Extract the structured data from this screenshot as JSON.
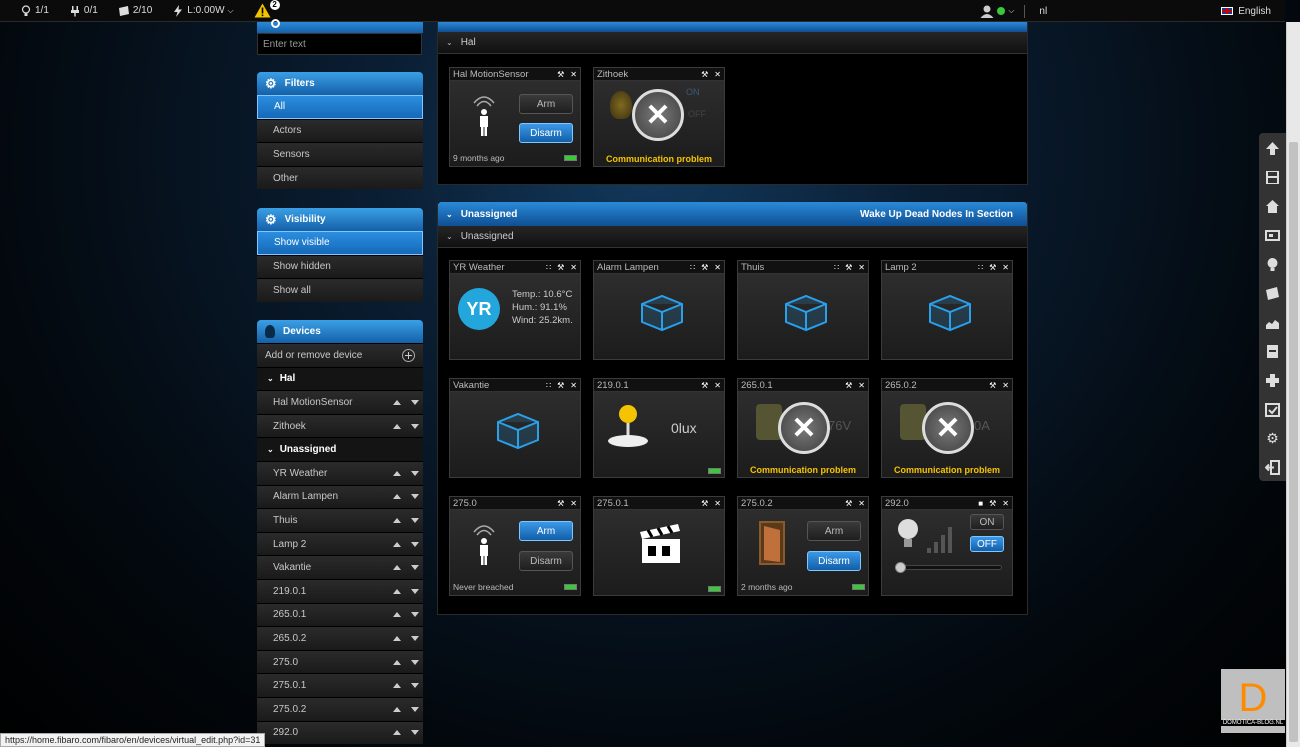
{
  "topbar": {
    "lights": "1/1",
    "plugs": "0/1",
    "blinds": "2/10",
    "power": "L:0.00W",
    "alerts": "2",
    "lang_short": "nl",
    "language": "English"
  },
  "search": {
    "placeholder": "Enter text"
  },
  "filters": {
    "title": "Filters",
    "items": [
      "All",
      "Actors",
      "Sensors",
      "Other"
    ]
  },
  "visibility": {
    "title": "Visibility",
    "items": [
      "Show visible",
      "Show hidden",
      "Show all"
    ]
  },
  "devices": {
    "title": "Devices",
    "add": "Add or remove device",
    "sections": [
      "Hal",
      "Unassigned"
    ],
    "hal_items": [
      "Hal MotionSensor",
      "Zithoek"
    ],
    "unassigned_items": [
      "YR Weather",
      "Alarm Lampen",
      "Thuis",
      "Lamp 2",
      "Vakantie",
      "219.0.1",
      "265.0.1",
      "265.0.2",
      "275.0",
      "275.0.1",
      "275.0.2",
      "292.0"
    ]
  },
  "main": {
    "hal_section": "Hal",
    "unassigned_section": "Unassigned",
    "wake_up": "Wake Up Dead Nodes In Section",
    "tiles": {
      "hal_motion": {
        "title": "Hal MotionSensor",
        "arm": "Arm",
        "disarm": "Disarm",
        "foot": "9 months ago"
      },
      "zithoek": {
        "title": "Zithoek",
        "on": "ON",
        "off": "OFF",
        "status": "Communication problem"
      },
      "yr": {
        "title": "YR Weather",
        "logo": "YR",
        "temp": "Temp.: 10.6°C",
        "hum": "Hum.: 91.1%",
        "wind": "Wind: 25.2km."
      },
      "alarm": {
        "title": "Alarm Lampen"
      },
      "thuis": {
        "title": "Thuis"
      },
      "lamp2": {
        "title": "Lamp 2"
      },
      "vakantie": {
        "title": "Vakantie"
      },
      "t219": {
        "title": "219.0.1",
        "value": "0lux"
      },
      "t265a": {
        "title": "265.0.1",
        "value": "76V",
        "status": "Communication problem"
      },
      "t265b": {
        "title": "265.0.2",
        "value": "0A",
        "status": "Communication problem"
      },
      "t275": {
        "title": "275.0",
        "arm": "Arm",
        "disarm": "Disarm",
        "foot": "Never breached"
      },
      "t2751": {
        "title": "275.0.1"
      },
      "t2752": {
        "title": "275.0.2",
        "arm": "Arm",
        "disarm": "Disarm",
        "foot": "2 months ago"
      },
      "t292": {
        "title": "292.0",
        "on": "ON",
        "off": "OFF"
      }
    }
  },
  "statusbar": {
    "url": "https://home.fibaro.com/fibaro/en/devices/virtual_edit.php?id=31"
  },
  "logo": {
    "letter": "D",
    "text": "DOMOTICA-BLOG.NL"
  }
}
